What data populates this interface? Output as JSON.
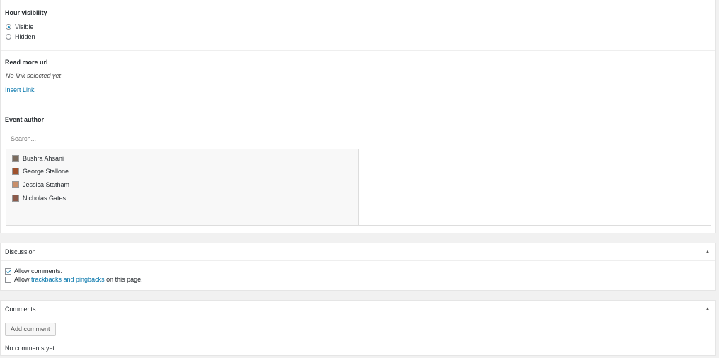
{
  "hour_visibility": {
    "label": "Hour visibility",
    "options": [
      {
        "label": "Visible",
        "checked": true
      },
      {
        "label": "Hidden",
        "checked": false
      }
    ]
  },
  "read_more": {
    "label": "Read more url",
    "status": "No link selected yet",
    "insert_link": "Insert Link"
  },
  "event_author": {
    "label": "Event author",
    "search_placeholder": "Search...",
    "choices": [
      {
        "name": "Bushra Ahsani",
        "avatar_color": "#7a6b5d"
      },
      {
        "name": "George Stallone",
        "avatar_color": "#a0522d"
      },
      {
        "name": "Jessica Statham",
        "avatar_color": "#c98f6a"
      },
      {
        "name": "Nicholas Gates",
        "avatar_color": "#8b5a4a"
      }
    ]
  },
  "discussion": {
    "title": "Discussion",
    "allow_comments": "Allow comments.",
    "allow_comments_checked": true,
    "allow_pingbacks_prefix": "Allow ",
    "allow_pingbacks_link": "trackbacks and pingbacks",
    "allow_pingbacks_suffix": " on this page.",
    "allow_pingbacks_checked": false
  },
  "comments": {
    "title": "Comments",
    "add_button": "Add comment",
    "empty_text": "No comments yet."
  },
  "colors": {
    "link": "#0073aa",
    "accent": "#1e8cbe"
  }
}
